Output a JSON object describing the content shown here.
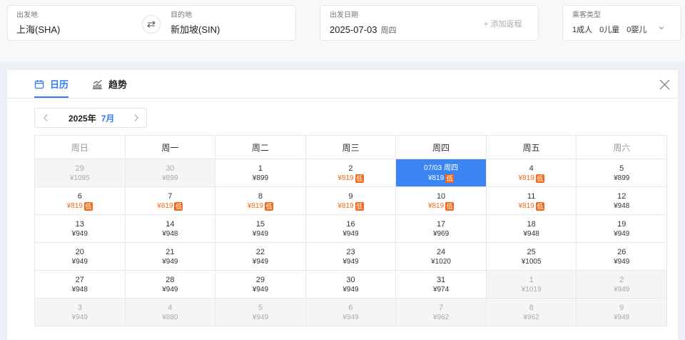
{
  "search": {
    "from": {
      "label": "出发地",
      "value": "上海(SHA)"
    },
    "to": {
      "label": "目的地",
      "value": "新加坡(SIN)"
    },
    "swap_icon": "swap-arrows-icon",
    "date": {
      "label": "出发日期",
      "value": "2025-07-03",
      "weekday": "周四",
      "add_return": "+ 添加返程"
    },
    "passengers": {
      "label": "乘客类型",
      "adults": "1成人",
      "children": "0儿童",
      "infants": "0婴儿",
      "dropdown_icon": "chevron-down-icon"
    }
  },
  "tabs": [
    {
      "label": "日历",
      "icon": "calendar-icon",
      "active": true
    },
    {
      "label": "趋势",
      "icon": "trend-chart-icon",
      "active": false
    }
  ],
  "close_icon": "close-icon",
  "month_nav": {
    "year": "2025年",
    "month": "7月",
    "prev_icon": "chevron-left-icon",
    "next_icon": "chevron-right-icon"
  },
  "calendar": {
    "weekdays": [
      {
        "label": "周日",
        "weekend": true
      },
      {
        "label": "周一",
        "weekend": false
      },
      {
        "label": "周二",
        "weekend": false
      },
      {
        "label": "周三",
        "weekend": false
      },
      {
        "label": "周四",
        "weekend": false
      },
      {
        "label": "周五",
        "weekend": false
      },
      {
        "label": "周六",
        "weekend": true
      }
    ],
    "low_badge": "低",
    "days": [
      {
        "day": "29",
        "price": "¥1095",
        "outside": true
      },
      {
        "day": "30",
        "price": "¥899",
        "outside": true
      },
      {
        "day": "1",
        "price": "¥899"
      },
      {
        "day": "2",
        "price": "¥819",
        "low": true
      },
      {
        "day": "07/03 周四",
        "price": "¥819",
        "low": true,
        "selected": true
      },
      {
        "day": "4",
        "price": "¥819",
        "low": true
      },
      {
        "day": "5",
        "price": "¥899"
      },
      {
        "day": "6",
        "price": "¥819",
        "low": true
      },
      {
        "day": "7",
        "price": "¥819",
        "low": true
      },
      {
        "day": "8",
        "price": "¥819",
        "low": true
      },
      {
        "day": "9",
        "price": "¥819",
        "low": true
      },
      {
        "day": "10",
        "price": "¥819",
        "low": true
      },
      {
        "day": "11",
        "price": "¥819",
        "low": true
      },
      {
        "day": "12",
        "price": "¥948"
      },
      {
        "day": "13",
        "price": "¥949"
      },
      {
        "day": "14",
        "price": "¥948"
      },
      {
        "day": "15",
        "price": "¥949"
      },
      {
        "day": "16",
        "price": "¥949"
      },
      {
        "day": "17",
        "price": "¥969"
      },
      {
        "day": "18",
        "price": "¥948"
      },
      {
        "day": "19",
        "price": "¥949"
      },
      {
        "day": "20",
        "price": "¥949"
      },
      {
        "day": "21",
        "price": "¥949"
      },
      {
        "day": "22",
        "price": "¥949"
      },
      {
        "day": "23",
        "price": "¥949"
      },
      {
        "day": "24",
        "price": "¥1020"
      },
      {
        "day": "25",
        "price": "¥1005"
      },
      {
        "day": "26",
        "price": "¥949"
      },
      {
        "day": "27",
        "price": "¥948"
      },
      {
        "day": "28",
        "price": "¥949"
      },
      {
        "day": "29",
        "price": "¥949"
      },
      {
        "day": "30",
        "price": "¥949"
      },
      {
        "day": "31",
        "price": "¥974"
      },
      {
        "day": "1",
        "price": "¥1019",
        "outside": true
      },
      {
        "day": "2",
        "price": "¥949",
        "outside": true
      },
      {
        "day": "3",
        "price": "¥949",
        "outside": true
      },
      {
        "day": "4",
        "price": "¥880",
        "outside": true
      },
      {
        "day": "5",
        "price": "¥949",
        "outside": true
      },
      {
        "day": "6",
        "price": "¥949",
        "outside": true
      },
      {
        "day": "7",
        "price": "¥962",
        "outside": true
      },
      {
        "day": "8",
        "price": "¥962",
        "outside": true
      },
      {
        "day": "9",
        "price": "¥949",
        "outside": true
      }
    ]
  },
  "colors": {
    "accent": "#2f7cf6",
    "selected": "#3a84f4",
    "low": "#f2691c",
    "outside_bg": "#f5f5f6",
    "muted": "#aaaaaa"
  }
}
